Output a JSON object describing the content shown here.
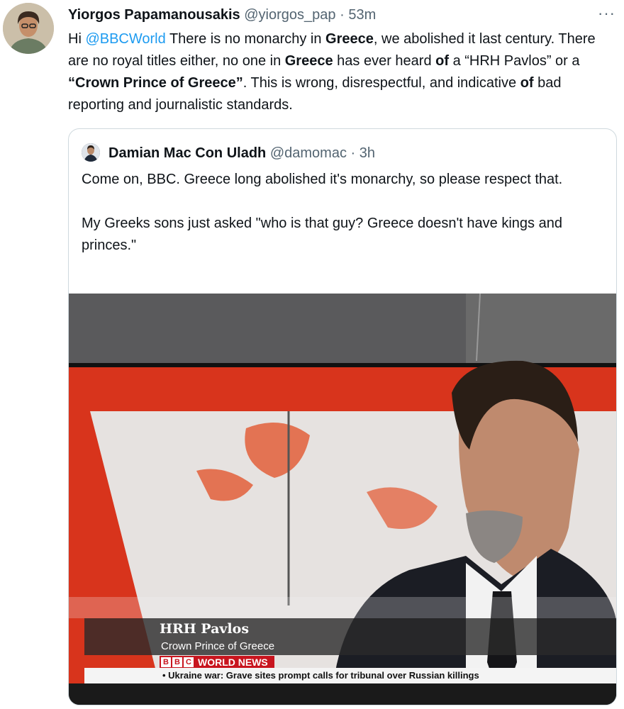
{
  "tweet": {
    "author_name": "Yiorgos Papamanousakis",
    "handle": "@yiorgos_pap",
    "separator": "·",
    "time": "53m",
    "more": "···",
    "text": {
      "t1": "Hi ",
      "mention": "@BBCWorld",
      "t2": " There is no monarchy in ",
      "b1": "Greece",
      "t3": ", we abolished it last century. There are no royal titles either, no one in ",
      "b2": "Greece",
      "t4": " has ever heard ",
      "b3": "of",
      "t5": " a “HRH Pavlos” or a ",
      "b4": "“Crown Prince of Greece”",
      "t6": ". This is wrong, disrespectful, and indicative ",
      "b5": "of",
      "t7": " bad reporting and journalistic standards."
    }
  },
  "quoted": {
    "author_name": "Damian Mac Con Uladh",
    "handle": "@damomac",
    "separator": "·",
    "time": "3h",
    "paragraph1": "Come on, BBC. Greece long abolished it's monarchy, so please respect that.",
    "paragraph2": "My Greeks sons just asked \"who is that guy? Greece doesn't have kings and  princes.\""
  },
  "tv": {
    "lower_third_name": "HRH Pavlos",
    "lower_third_title": "Crown Prince of Greece",
    "bbc_letters": [
      "B",
      "B",
      "C"
    ],
    "channel": "WORLD NEWS",
    "ticker": "• Ukraine war: Grave sites prompt calls for tribunal over Russian killings"
  },
  "colors": {
    "link": "#1d9bf0",
    "muted": "#536471",
    "bbc_red": "#c8141e",
    "studio_red": "#d8341c"
  }
}
